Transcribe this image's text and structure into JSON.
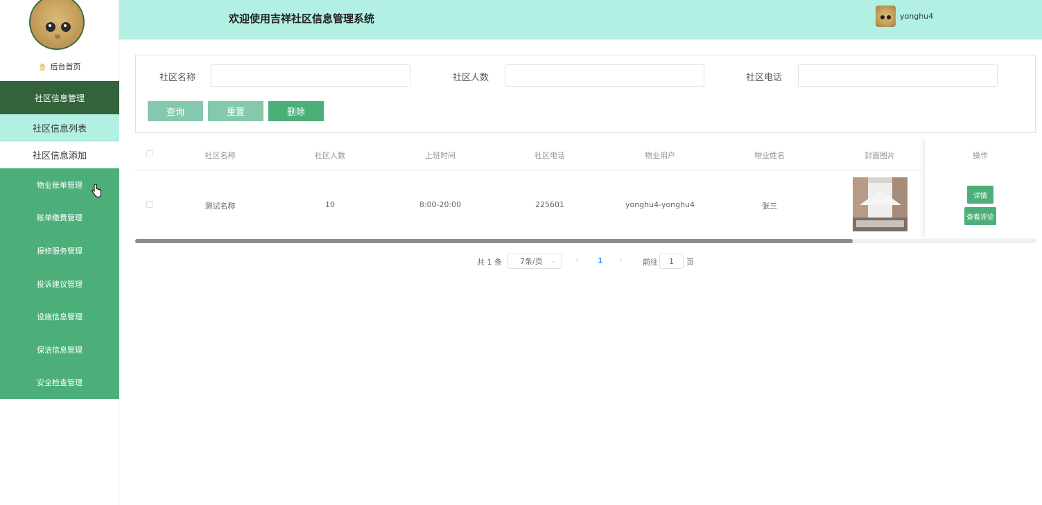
{
  "header": {
    "title": "欢迎使用吉祥社区信息管理系统",
    "username": "yonghu4"
  },
  "sidebar": {
    "home_label": "后台首页",
    "group_title": "社区信息管理",
    "sub_items": [
      {
        "label": "社区信息列表"
      },
      {
        "label": "社区信息添加"
      }
    ],
    "items": [
      {
        "label": "物业账单管理"
      },
      {
        "label": "账单缴费管理"
      },
      {
        "label": "报修服务管理"
      },
      {
        "label": "投诉建议管理"
      },
      {
        "label": "设施信息管理"
      },
      {
        "label": "保洁信息管理"
      },
      {
        "label": "安全检查管理"
      }
    ]
  },
  "search": {
    "fields": [
      {
        "label": "社区名称",
        "value": ""
      },
      {
        "label": "社区人数",
        "value": ""
      },
      {
        "label": "社区电话",
        "value": ""
      }
    ],
    "buttons": {
      "query": "查询",
      "reset": "重置",
      "delete": "删除"
    }
  },
  "table": {
    "headers": [
      "社区名称",
      "社区人数",
      "上班时间",
      "社区电话",
      "物业用户",
      "物业姓名",
      "封面图片",
      "操作"
    ],
    "rows": [
      {
        "name": "测试名称",
        "count": "10",
        "hours": "8:00-20:00",
        "phone": "225601",
        "user": "yonghu4-yonghu4",
        "manager": "张三",
        "actions": {
          "detail": "详情",
          "comments": "查看评论"
        }
      }
    ]
  },
  "pagination": {
    "total": "共 1 条",
    "page_size": "7条/页",
    "current": "1",
    "goto_label": "前往",
    "goto_value": "1",
    "page_suffix": "页"
  },
  "colors": {
    "accent": "#4caf7a",
    "header_bg": "#b2f0e3",
    "sidebar_group": "#33633b"
  }
}
